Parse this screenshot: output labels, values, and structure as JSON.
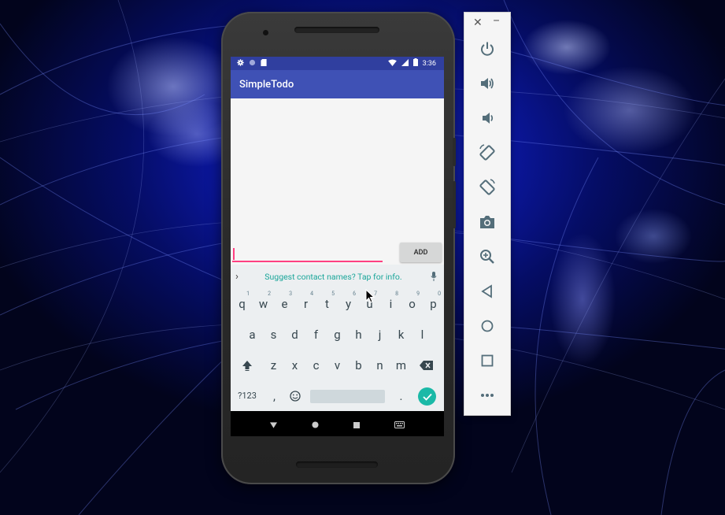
{
  "device": {
    "status_bar": {
      "time": "3:36"
    },
    "app_bar": {
      "title": "SimpleTodo"
    },
    "todo_input": {
      "value": "",
      "placeholder": ""
    },
    "add_button": {
      "label": "ADD"
    },
    "keyboard": {
      "suggestion": "Suggest contact names? Tap for info.",
      "row1": [
        {
          "key": "q",
          "hint": "1"
        },
        {
          "key": "w",
          "hint": "2"
        },
        {
          "key": "e",
          "hint": "3"
        },
        {
          "key": "r",
          "hint": "4"
        },
        {
          "key": "t",
          "hint": "5"
        },
        {
          "key": "y",
          "hint": "6"
        },
        {
          "key": "u",
          "hint": "7"
        },
        {
          "key": "i",
          "hint": "8"
        },
        {
          "key": "o",
          "hint": "9"
        },
        {
          "key": "p",
          "hint": "0"
        }
      ],
      "row2": [
        "a",
        "s",
        "d",
        "f",
        "g",
        "h",
        "j",
        "k",
        "l"
      ],
      "row3": [
        "z",
        "x",
        "c",
        "v",
        "b",
        "n",
        "m"
      ],
      "row4": {
        "symbols": "?123",
        "comma": ",",
        "period": "."
      }
    }
  },
  "toolbar": {
    "buttons": [
      "power-icon",
      "volume-up-icon",
      "volume-down-icon",
      "rotate-left-icon",
      "rotate-right-icon",
      "camera-icon",
      "zoom-icon",
      "back-icon",
      "home-icon",
      "overview-icon",
      "more-icon"
    ]
  },
  "colors": {
    "primary": "#3f51b5",
    "primary_dark": "#303f9f",
    "accent": "#ff4081",
    "keyboard_accent": "#1ab9a7"
  }
}
